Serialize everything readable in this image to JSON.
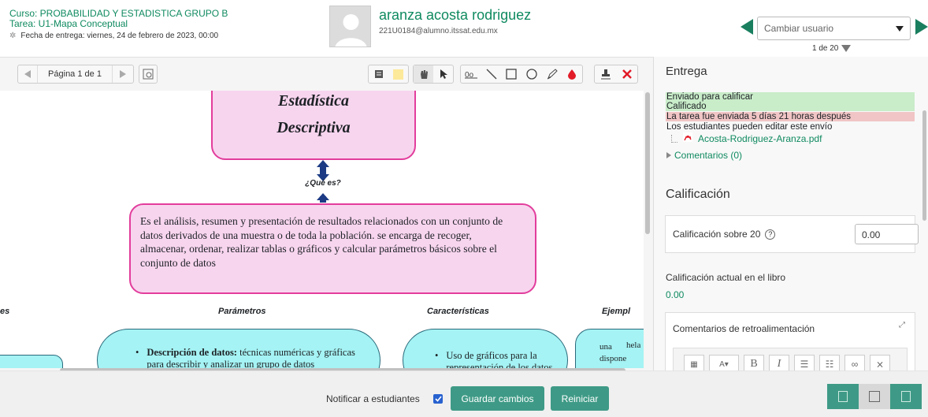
{
  "header": {
    "course": "Curso: PROBABILIDAD Y ESTADISTICA GRUPO B",
    "task": "Tarea: U1-Mapa Conceptual",
    "due_date": "Fecha de entrega: viernes, 24 de febrero de 2023, 00:00",
    "user_name": "aranza acosta rodriguez",
    "user_email": "221U0184@alumno.itssat.edu.mx",
    "change_user_placeholder": "Cambiar usuario",
    "counter": "1 de 20"
  },
  "viewer": {
    "page_label": "Página 1 de 1",
    "tools": [
      "comment-tool",
      "highlight-tool",
      "pan-tool",
      "select-tool",
      "stamp-text-tool",
      "line-tool",
      "rectangle-tool",
      "oval-tool",
      "pen-tool",
      "color-tool",
      "stamp-tool",
      "delete-tool"
    ],
    "document": {
      "title_line1": "Estadística",
      "title_line2": "Descriptiva",
      "question": "¿Qué es?",
      "definition": "Es el análisis, resumen y presentación de resultados relacionados con un conjunto de datos derivados de una muestra o de toda la población.  se encarga de recoger, almacenar, ordenar, realizar tablas o gráficos y calcular parámetros básicos sobre el conjunto de datos",
      "col_partial_left": "es",
      "col_parametros": "Parámetros",
      "col_caracteristicas": "Características",
      "col_ejemplos": "Ejempl",
      "param_bold": "Descripción de datos:",
      "param_text": " técnicas numéricas y gráficas para describir y analizar un grupo de datos",
      "carac_text": "Uso de gráficos para la representación de los datos",
      "ejemplo_text_1": "una",
      "ejemplo_text_2": "hela",
      "ejemplo_text_3": "dispone"
    }
  },
  "panel": {
    "entrega_title": "Entrega",
    "status_1": "Enviado para calificar",
    "status_2": "Calificado",
    "status_3": "La tarea fue enviada 5 días 21 horas después",
    "status_4": "Los estudiantes pueden editar este envío",
    "file_name": "Acosta-Rodriguez-Aranza.pdf",
    "comments": "Comentarios (0)",
    "calificacion_title": "Calificación",
    "grade_label": "Calificación sobre 20",
    "grade_value": "0.00",
    "current_grade_label": "Calificación actual en el libro",
    "current_grade_value": "0.00",
    "feedback_label": "Comentarios de retroalimentación"
  },
  "footer": {
    "notify_label": "Notificar a estudiantes",
    "save_label": "Guardar cambios",
    "reset_label": "Reiniciar"
  },
  "colors": {
    "brand_green": "#0f8a5f",
    "button_green": "#3e9a86",
    "status_green": "#c9ecc9",
    "status_red": "#f1c5c5",
    "concept_pink": "#f8d5ef",
    "concept_border": "#e23d9c",
    "concept_blue": "#a5f3f4"
  }
}
